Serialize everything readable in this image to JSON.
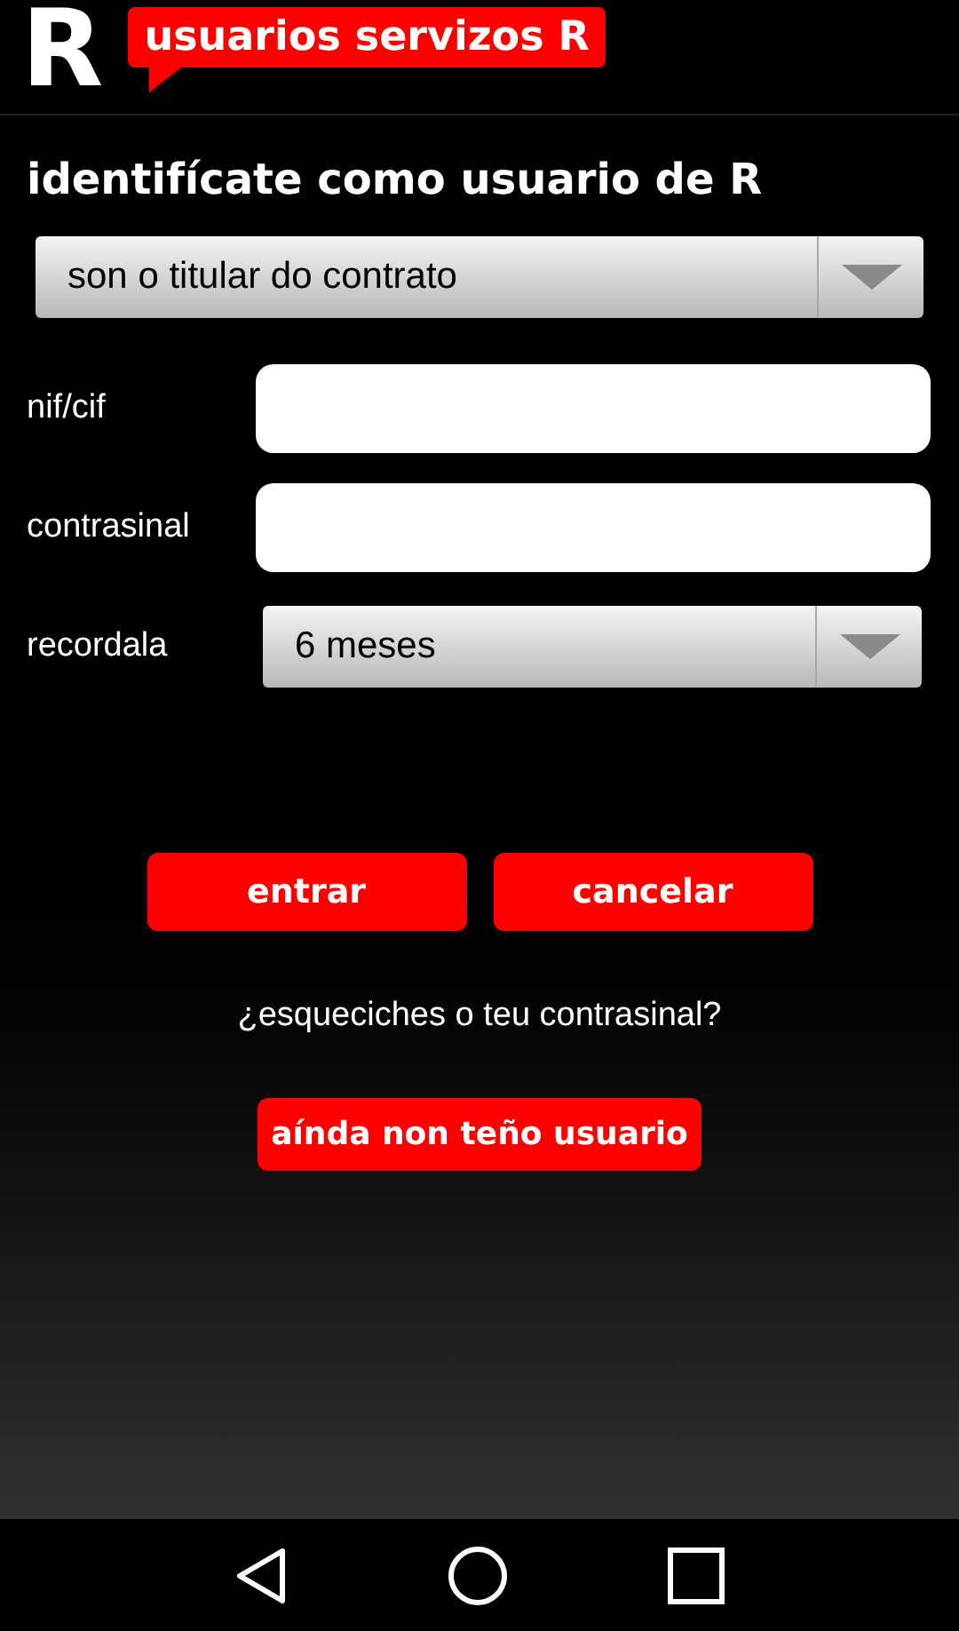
{
  "header": {
    "logo": "R",
    "title": "usuarios servizos R"
  },
  "heading": "identifícate como usuario de R",
  "user_type": {
    "value": "son o titular do contrato"
  },
  "fields": [
    {
      "label": "nif/cif",
      "kind": "text"
    },
    {
      "label": "contrasinal",
      "kind": "password"
    },
    {
      "label": "recordala",
      "kind": "select",
      "value": "6 meses"
    }
  ],
  "buttons": [
    "entrar",
    "cancelar"
  ],
  "forgot_link": "¿esqueciches o teu contrasinal?",
  "register_button": "aínda non teño usuario"
}
